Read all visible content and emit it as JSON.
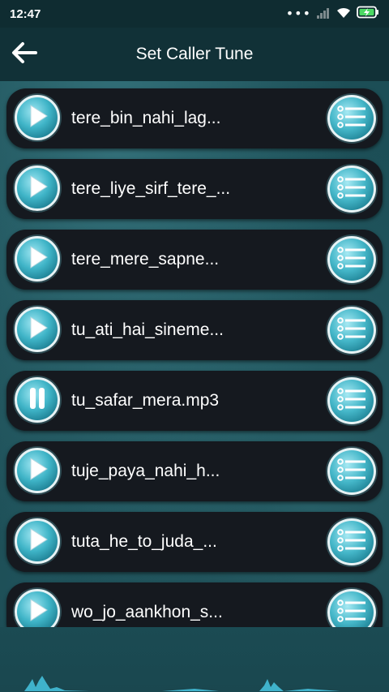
{
  "status_bar": {
    "time": "12:47",
    "dots": "•••",
    "icons": [
      "signal-icon",
      "wifi-icon",
      "battery-charging-icon"
    ]
  },
  "app_bar": {
    "back_icon": "arrow-left-icon",
    "title": "Set Caller Tune"
  },
  "songs": [
    {
      "name": "tere_bin_nahi_lag...",
      "state": "play"
    },
    {
      "name": "tere_liye_sirf_tere_...",
      "state": "play"
    },
    {
      "name": "tere_mere_sapne...",
      "state": "play"
    },
    {
      "name": "tu_ati_hai_sineme...",
      "state": "play"
    },
    {
      "name": "tu_safar_mera.mp3",
      "state": "pause"
    },
    {
      "name": "tuje_paya_nahi_h...",
      "state": "play"
    },
    {
      "name": "tuta_he_to_juda_...",
      "state": "play"
    },
    {
      "name": "wo_jo_aankhon_s...",
      "state": "play"
    }
  ],
  "colors": {
    "accent": "#3fb4c7",
    "row_bg": "#15191f",
    "appbar_bg": "#113137"
  }
}
